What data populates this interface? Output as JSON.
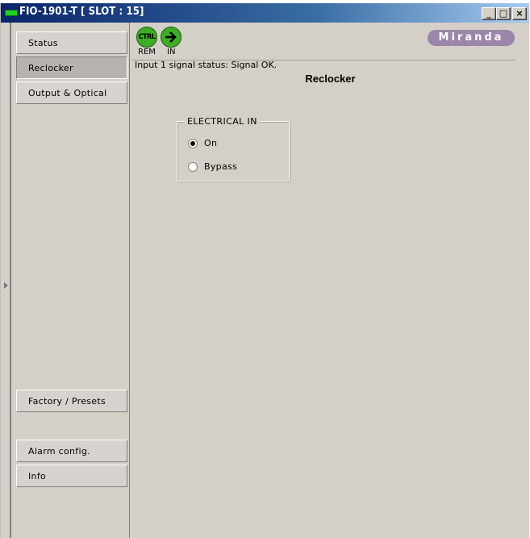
{
  "window": {
    "title": "FIO-1901-T [ SLOT : 15]",
    "controls": {
      "minimize": "_",
      "maximize": "□",
      "close": "×"
    }
  },
  "sidebar": {
    "items": [
      {
        "label": "Status",
        "active": false
      },
      {
        "label": "Reclocker",
        "active": true
      },
      {
        "label": "Output & Optical",
        "active": false
      },
      {
        "label": "Factory / Presets",
        "active": false
      },
      {
        "label": "Alarm config.",
        "active": false
      },
      {
        "label": "Info",
        "active": false
      }
    ]
  },
  "icons": {
    "ctrl": {
      "text": "CTRL",
      "caption": "REM"
    },
    "input": {
      "caption": "IN"
    },
    "logo": "Miranda"
  },
  "status_text": "Input 1 signal status: Signal OK.",
  "page_title": "Reclocker",
  "electrical_in": {
    "legend": "ELECTRICAL IN",
    "options": [
      {
        "label": "On",
        "selected": true
      },
      {
        "label": "Bypass",
        "selected": false
      }
    ]
  },
  "colors": {
    "titlebar_start": "#0a246a",
    "titlebar_end": "#a6caf0",
    "status_green": "#3dae24",
    "logo_purple": "#9a86a8"
  }
}
